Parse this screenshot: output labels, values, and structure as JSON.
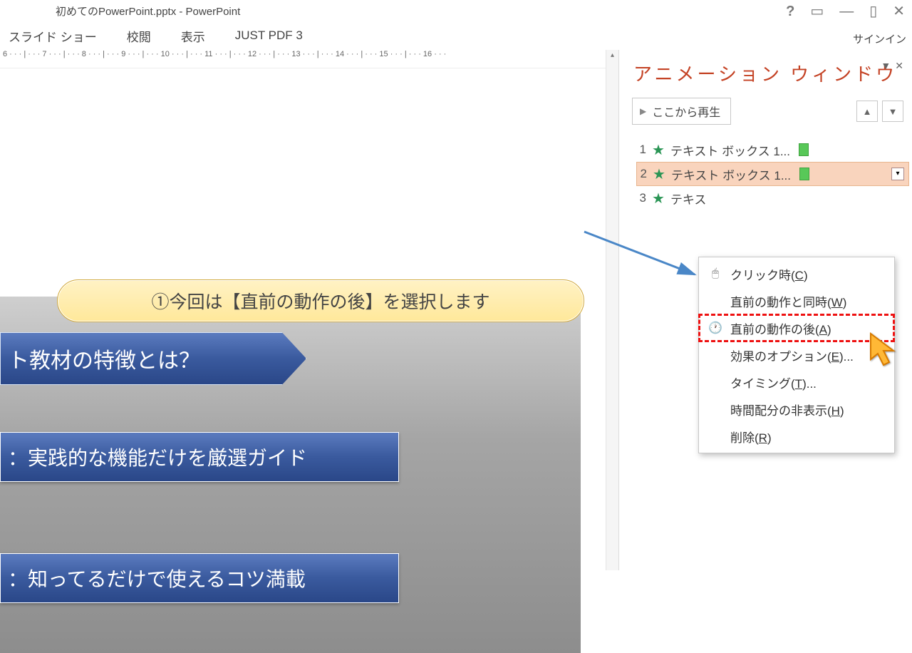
{
  "title": "初めてのPowerPoint.pptx - PowerPoint",
  "ribbon": [
    "スライド ショー",
    "校閲",
    "表示",
    "JUST PDF 3"
  ],
  "signin": "サインイン",
  "ruler": "6 · · · | · · · 7 · · · | · · · 8 · · · | · · · 9 · · · | · · · 10 · · · | · · · 11 · · · | · · · 12 · · · | · · · 13 · · · | · · · 14 · · · | · · · 15 · · · | · · · 16 · · ·",
  "slide": {
    "t1": "ト教材の特徴とは？",
    "t2": "：実践的な機能だけを厳選ガイド",
    "t3": "：知ってるだけで使えるコツ満載"
  },
  "callout": "①今回は【直前の動作の後】を選択します",
  "anim": {
    "title": "アニメーション ウィンドウ",
    "play": "ここから再生",
    "items": [
      {
        "n": "1",
        "label": "テキスト ボックス 1..."
      },
      {
        "n": "2",
        "label": "テキスト ボックス 1..."
      },
      {
        "n": "3",
        "label": "テキス"
      }
    ]
  },
  "menu": {
    "click": {
      "text": "クリック時(",
      "key": "C",
      "tail": ")"
    },
    "with": {
      "text": "直前の動作と同時(",
      "key": "W",
      "tail": ")"
    },
    "after": {
      "text": "直前の動作の後(",
      "key": "A",
      "tail": ")"
    },
    "effect": {
      "text": "効果のオプション(",
      "key": "E",
      "tail": ")..."
    },
    "timing": {
      "text": "タイミング(",
      "key": "T",
      "tail": ")..."
    },
    "hide": {
      "text": "時間配分の非表示(",
      "key": "H",
      "tail": ")"
    },
    "remove": {
      "text": "削除(",
      "key": "R",
      "tail": ")"
    }
  }
}
